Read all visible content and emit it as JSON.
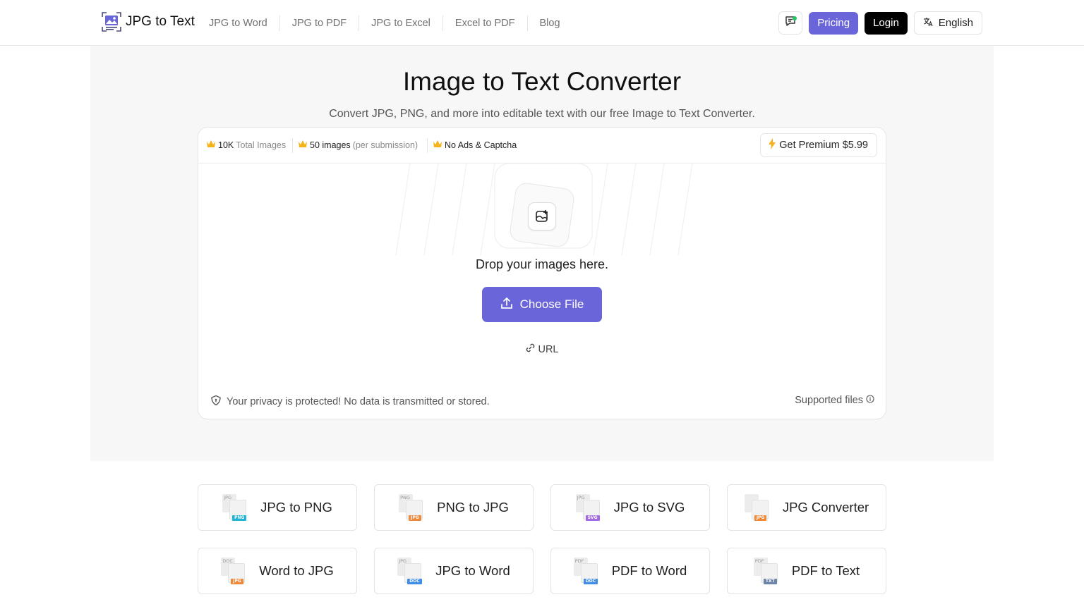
{
  "header": {
    "brand": "JPG to Text",
    "nav": [
      "JPG to Word",
      "JPG to PDF",
      "JPG to Excel",
      "Excel to PDF",
      "Blog"
    ],
    "pricing": "Pricing",
    "login": "Login",
    "language": "English"
  },
  "hero": {
    "title": "Image to Text Converter",
    "subtitle": "Convert JPG, PNG, and more into editable text with our free Image to Text Converter."
  },
  "upload": {
    "features": [
      {
        "strong": "10K",
        "muted": "Total Images"
      },
      {
        "strong": "50 images",
        "muted": "(per submission)"
      },
      {
        "strong": "No Ads & Captcha",
        "muted": ""
      }
    ],
    "premium": "Get Premium $5.99",
    "drop_text": "Drop your images here.",
    "choose_file": "Choose File",
    "url": "URL",
    "privacy": "Your privacy is protected! No data is transmitted or stored.",
    "supported": "Supported files"
  },
  "tools": [
    {
      "label": "JPG to PNG",
      "from": "JPG",
      "to": "PNG",
      "color": "#1fb5d6"
    },
    {
      "label": "PNG to JPG",
      "from": "PNG",
      "to": "JPG",
      "color": "#f0883a"
    },
    {
      "label": "JPG to SVG",
      "from": "JPG",
      "to": "SVG",
      "color": "#a26be0"
    },
    {
      "label": "JPG Converter",
      "from": "",
      "to": "JPG",
      "color": "#f0883a"
    },
    {
      "label": "Word to JPG",
      "from": "DOC",
      "to": "JPG",
      "color": "#f0883a"
    },
    {
      "label": "JPG to Word",
      "from": "JPG",
      "to": "DOC",
      "color": "#3f8de6"
    },
    {
      "label": "PDF to Word",
      "from": "PDF",
      "to": "DOC",
      "color": "#3f8de6"
    },
    {
      "label": "PDF to Text",
      "from": "PDF",
      "to": "TXT",
      "color": "#6b84a8"
    }
  ],
  "colors": {
    "accent": "#6a66d9",
    "crown": "#f5b21b",
    "status_dot": "#22c55e"
  }
}
